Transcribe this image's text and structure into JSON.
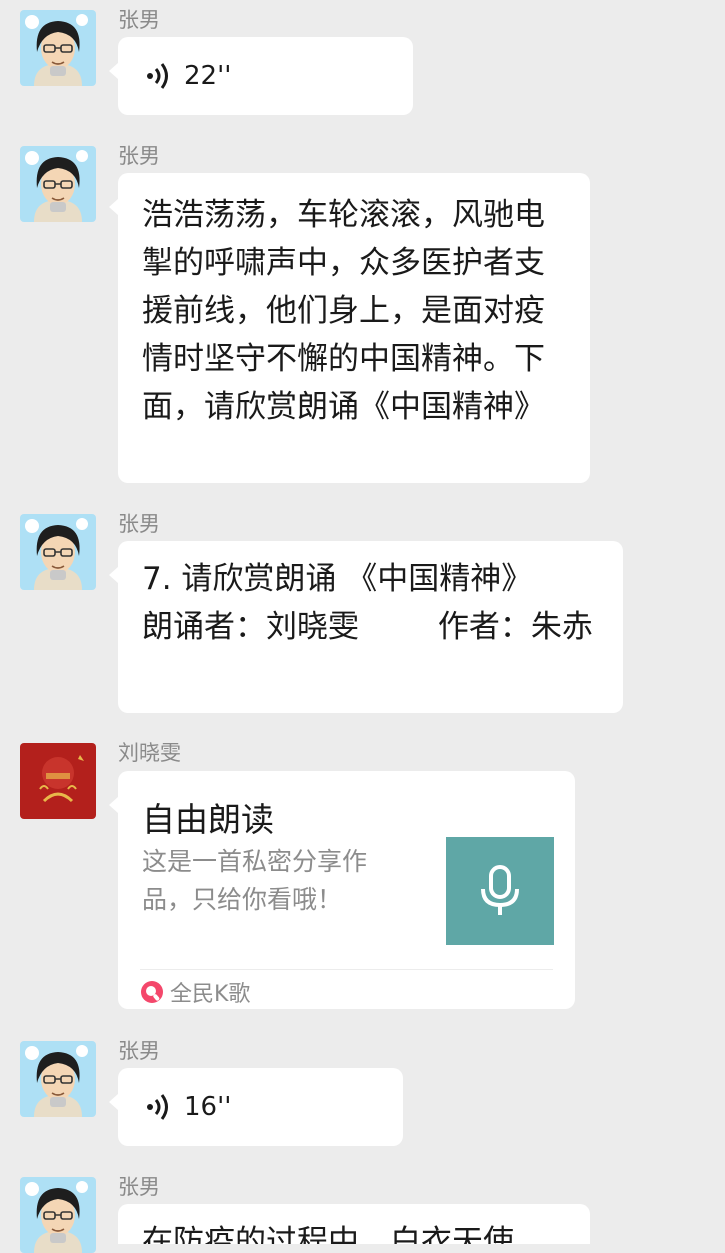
{
  "messages": [
    {
      "sender": "张男",
      "type": "voice",
      "duration": "22''"
    },
    {
      "sender": "张男",
      "type": "text",
      "text": "浩浩荡荡，车轮滚滚，风驰电掣的呼啸声中，众多医护者支援前线，他们身上，是面对疫情时坚守不懈的中国精神。下面，请欣赏朗诵《中国精神》"
    },
    {
      "sender": "张男",
      "type": "text",
      "text": "7. 请欣赏朗诵 《中国精神》\n朗诵者：刘晓雯        作者：朱赤"
    },
    {
      "sender": "刘晓雯",
      "type": "share",
      "title": "自由朗读",
      "description": "这是一首私密分享作品，只给你看哦！",
      "source": "全民K歌",
      "thumbnail_icon": "microphone-icon",
      "source_icon": "kge-logo-icon"
    },
    {
      "sender": "张男",
      "type": "voice",
      "duration": "16''"
    },
    {
      "sender": "张男",
      "type": "text",
      "text": "在防疫的过程中，白衣天使"
    }
  ],
  "colors": {
    "background": "#ececec",
    "bubble": "#ffffff",
    "name": "#8a8a8a",
    "thumb": "#5fa7a6",
    "red_avatar": "#b3201c"
  }
}
